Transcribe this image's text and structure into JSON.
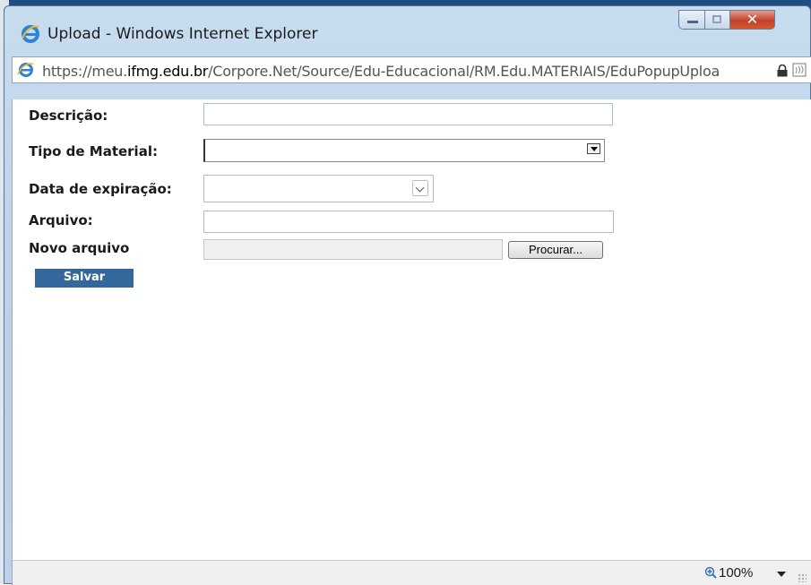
{
  "window": {
    "title": "Upload - Windows Internet Explorer",
    "controls": {
      "close": "✕"
    }
  },
  "address_bar": {
    "url_prefix": "https://meu.",
    "url_host": "ifmg.edu.br",
    "url_path": "/Corpore.Net/Source/Edu-Educacional/RM.Edu.MATERIAIS/EduPopupUploa"
  },
  "form": {
    "descricao_label": "Descrição:",
    "descricao_value": "",
    "tipo_material_label": "Tipo de Material:",
    "tipo_material_value": "",
    "data_expiracao_label": "Data de expiração:",
    "data_expiracao_value": "",
    "arquivo_label": "Arquivo:",
    "arquivo_value": "",
    "novo_arquivo_label": "Novo arquivo",
    "novo_arquivo_value": "",
    "browse_label": "Procurar...",
    "save_label": "Salvar"
  },
  "status_bar": {
    "zoom": "100%"
  },
  "icons": {
    "browser": "ie-logo-icon",
    "lock": "lock-icon",
    "feed": "rss-feed-icon",
    "zoom": "zoom-icon"
  },
  "colors": {
    "save_button": "#34679b",
    "close_button": "#c3432b"
  }
}
